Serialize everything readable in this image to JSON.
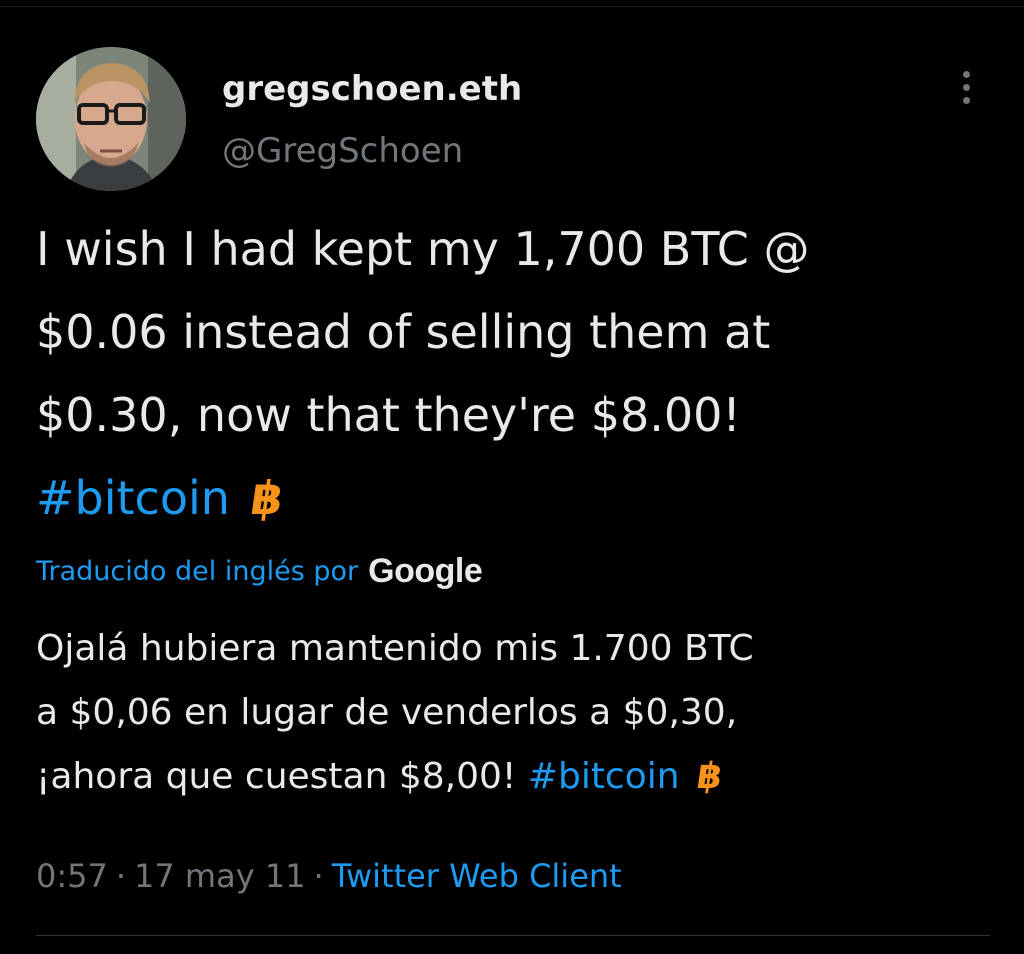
{
  "author": {
    "display_name": "gregschoen.eth",
    "handle": "@GregSchoen"
  },
  "more_icon": "more-vertical-icon",
  "tweet": {
    "lines": [
      "I wish I had kept my 1,700 BTC @",
      "$0.06 instead of selling them at",
      "$0.30, now that they're $8.00!"
    ],
    "hashtag": "#bitcoin",
    "emoji": "฿"
  },
  "translation": {
    "label": "Traducido del inglés por",
    "provider": "Google",
    "lines": [
      "Ojalá hubiera mantenido mis 1.700 BTC",
      "a $0,06 en lugar de venderlos a $0,30,",
      "¡ahora que cuestan $8,00!"
    ],
    "hashtag": "#bitcoin",
    "emoji": "฿"
  },
  "meta": {
    "time": "0:57",
    "separator": "·",
    "date": "17 may 11",
    "source": "Twitter Web Client"
  },
  "colors": {
    "background": "#000000",
    "text": "#e7e9ea",
    "secondary": "#71767b",
    "link": "#1d9bf0",
    "bitcoin": "#f7931a"
  }
}
